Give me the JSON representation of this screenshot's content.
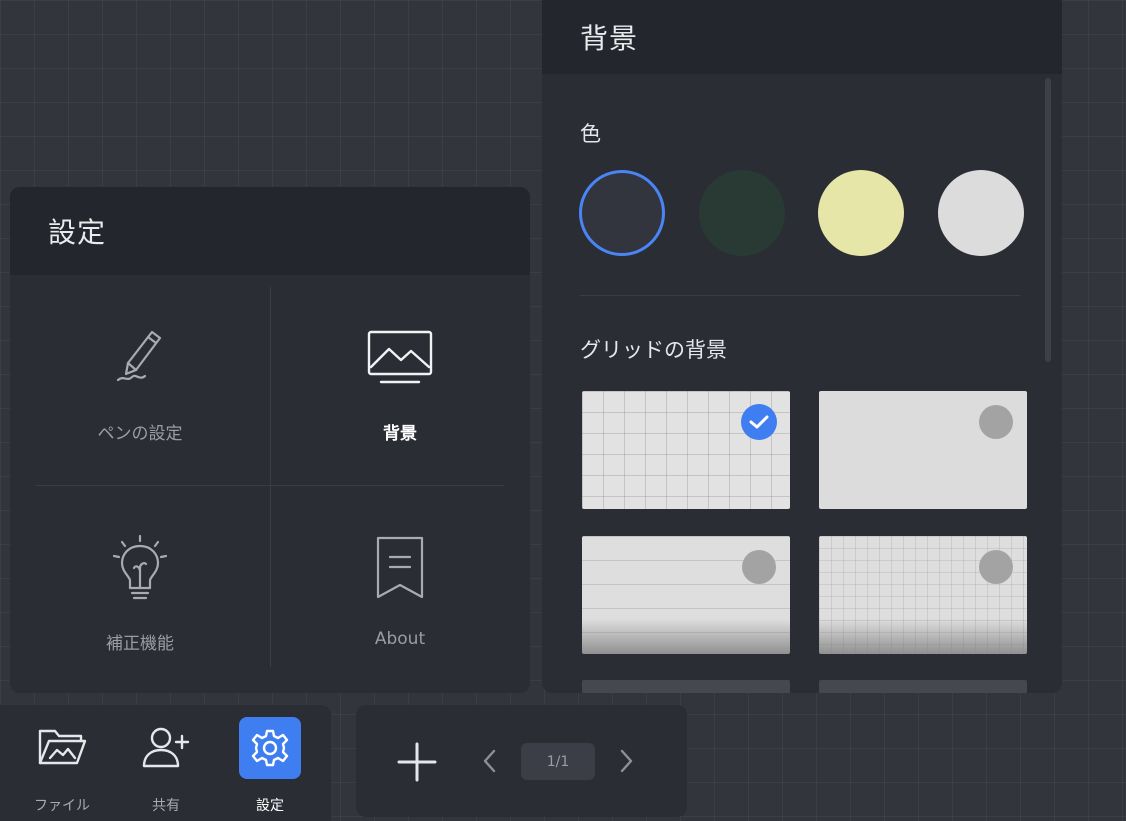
{
  "settings": {
    "title": "設定",
    "items": [
      {
        "label": "ペンの設定",
        "icon": "pen-icon"
      },
      {
        "label": "背景",
        "icon": "landscape-icon",
        "active": true
      },
      {
        "label": "補正機能",
        "icon": "lightbulb-icon"
      },
      {
        "label": "About",
        "icon": "bookmark-icon"
      }
    ]
  },
  "background": {
    "title": "背景",
    "color_section": "色",
    "colors": [
      {
        "hex": "#32353d",
        "selected": true
      },
      {
        "hex": "#283a33",
        "selected": false
      },
      {
        "hex": "#e6e6a8",
        "selected": false
      },
      {
        "hex": "#dcdcdc",
        "selected": false
      }
    ],
    "grid_section": "グリッドの背景",
    "grid_options": [
      {
        "style": "square-grid",
        "selected": true
      },
      {
        "style": "plain",
        "selected": false
      },
      {
        "style": "ruled-lines",
        "selected": false
      },
      {
        "style": "fine-grid",
        "selected": false
      }
    ]
  },
  "toolbar": {
    "file_label": "ファイル",
    "share_label": "共有",
    "settings_label": "設定",
    "page_indicator": "1/1"
  },
  "colors": {
    "accent": "#3f7ef0",
    "panel": "#2a2d34",
    "header": "#23262c",
    "canvas": "#32353b"
  }
}
